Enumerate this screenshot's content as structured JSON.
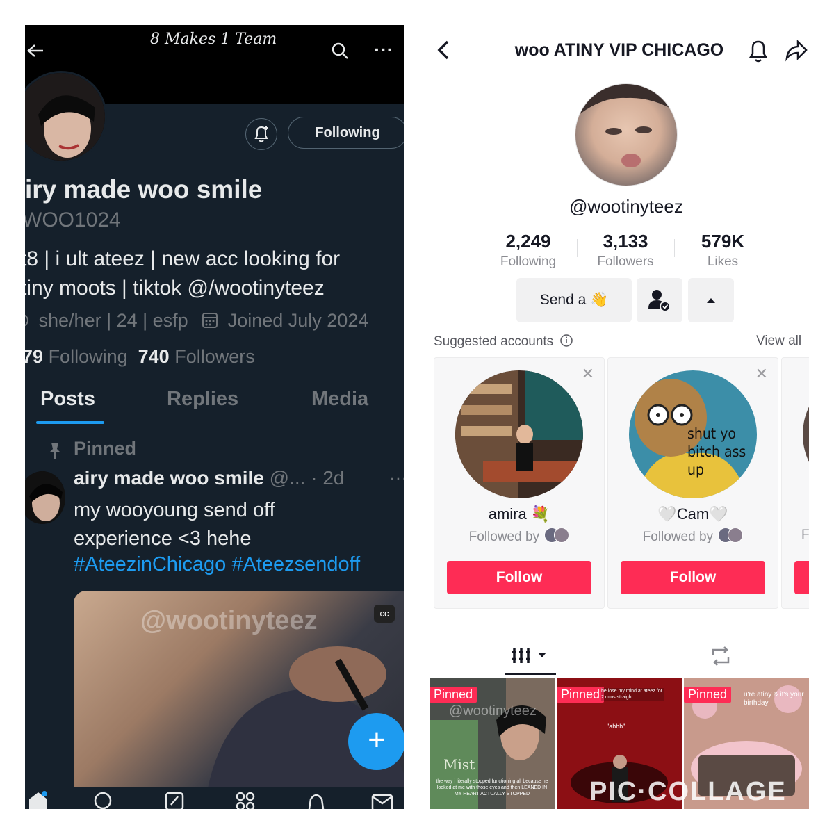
{
  "twitter": {
    "header_title": "8 Makes 1 Team",
    "display_name": "iry made woo smile",
    "handle": "WOO1024",
    "bio_line1": "t8 | i ult ateez | new acc looking for",
    "bio_line2": "tiny moots | tiktok @/wootinyteez",
    "pronouns": "she/her | 24 | esfp",
    "joined": "Joined July 2024",
    "following_count": "79",
    "following_label": "Following",
    "followers_count": "740",
    "followers_label": "Followers",
    "follow_button": "Following",
    "tabs": [
      "Posts",
      "Replies",
      "Media"
    ],
    "pinned_label": "Pinned",
    "post": {
      "author": "airy made woo smile",
      "meta": "@... · 2d",
      "text_line1": "my wooyoung send off",
      "text_line2": "experience <3 hehe",
      "hashtags": "#AteezinChicago #Ateezsendoff",
      "media_watermark": "@wootinyteez",
      "cc_badge": "cc"
    },
    "fab": "+",
    "accent": "#1d9bf0"
  },
  "tiktok": {
    "title": "woo ATINY VIP CHICAGO",
    "username": "@wootinyteez",
    "stats": [
      {
        "value": "2,249",
        "label": "Following"
      },
      {
        "value": "3,133",
        "label": "Followers"
      },
      {
        "value": "579K",
        "label": "Likes"
      }
    ],
    "send_button": "Send a 👋",
    "suggested_label": "Suggested accounts",
    "view_all": "View all",
    "suggestions": [
      {
        "name": "amira 💐",
        "followed_by": "Followed by",
        "button": "Follow"
      },
      {
        "name": "🤍Cam🤍",
        "followed_by": "Followed by",
        "button": "Follow"
      }
    ],
    "third_card_fby": "F",
    "cam_avatar_text": "shut yo bitch ass up",
    "thumbnails": [
      {
        "pin": "Pinned",
        "caption": "the way i literally stopped functioning all because he looked at me with those eyes and then LEANED IN MY HEART ACTUALLY STOPPED",
        "watermark": "@wootinyteez",
        "sign": "Mist"
      },
      {
        "pin": "Pinned",
        "caption": "he lose my mind at ateez for 2 mins straight",
        "sub": "\"ahhh\""
      },
      {
        "pin": "Pinned",
        "caption": "u're atiny & it's your birthday"
      }
    ],
    "collage_watermark": "PIC·COLLAGE",
    "accent": "#fe2c55"
  }
}
